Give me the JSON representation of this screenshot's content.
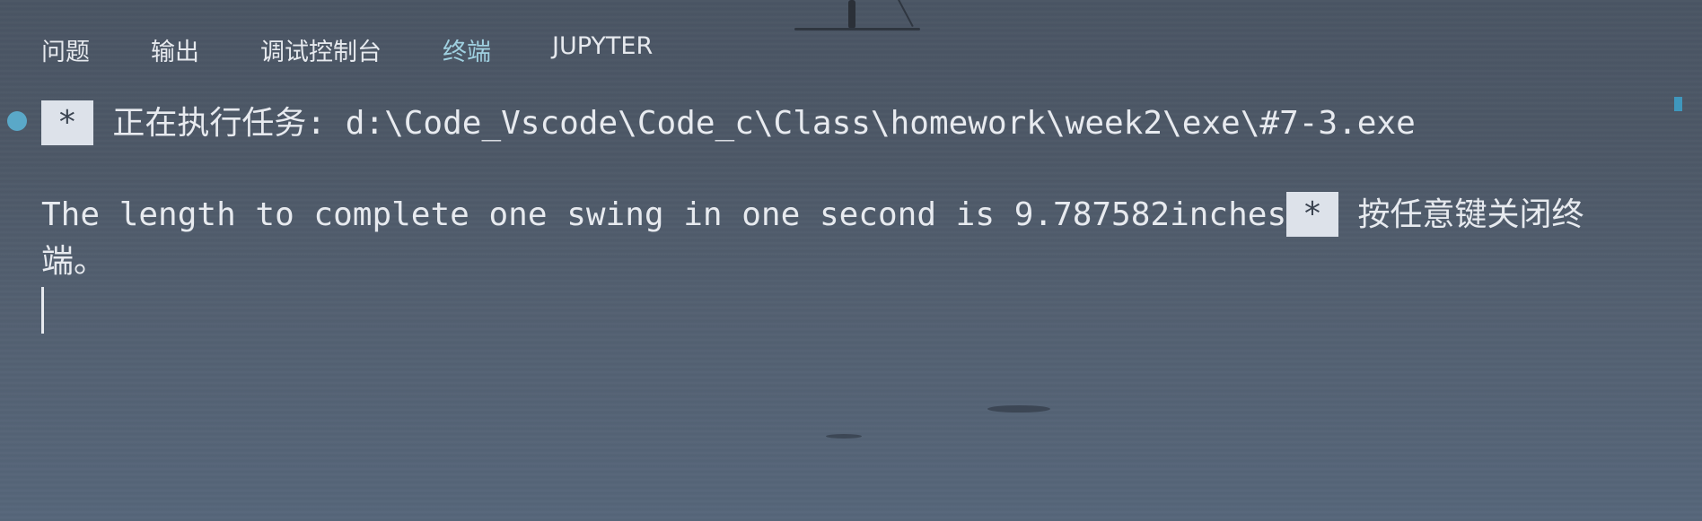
{
  "panel": {
    "tabs": [
      {
        "label": "问题",
        "active": false
      },
      {
        "label": "输出",
        "active": false
      },
      {
        "label": "调试控制台",
        "active": false
      },
      {
        "label": "终端",
        "active": true
      },
      {
        "label": "JUPYTER",
        "active": false
      }
    ]
  },
  "terminal": {
    "task_badge": "*",
    "task_line": "正在执行任务: d:\\Code_Vscode\\Code_c\\Class\\homework\\week2\\exe\\#7-3.exe",
    "output_text": "The length to complete one swing in one second is 9.787582inches",
    "close_badge": "*",
    "close_prompt": "按任意键关闭终端。"
  },
  "colors": {
    "active_tab": "#9fd0e0",
    "task_dot": "#5aa8c8",
    "text": "#e7eaef",
    "badge_bg": "#dde2ea"
  }
}
